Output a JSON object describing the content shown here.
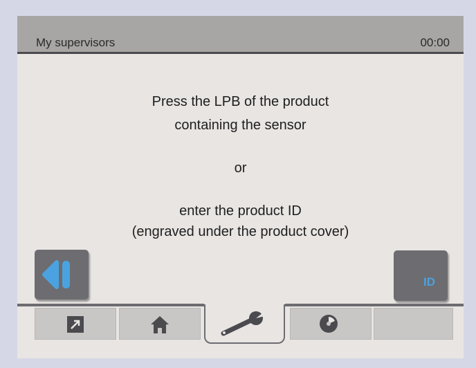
{
  "header": {
    "title": "My supervisors",
    "clock": "00:00"
  },
  "message": {
    "line1": "Press the LPB of the product",
    "line2": "containing the sensor",
    "or": "or",
    "line3": "enter the product ID",
    "line4": "(engraved under the product cover)"
  },
  "buttons": {
    "back_icon": "back-icon",
    "id_label": "ID"
  },
  "tabs": [
    {
      "icon": "shortcut-arrow-icon"
    },
    {
      "icon": "home-icon"
    },
    {
      "icon": "wrench-icon",
      "active": true
    },
    {
      "icon": "disc-icon"
    },
    {
      "icon": ""
    }
  ],
  "colors": {
    "accent": "#4aa3e0",
    "header_bg": "#a8a6a4",
    "button_bg": "#6d6c70"
  }
}
